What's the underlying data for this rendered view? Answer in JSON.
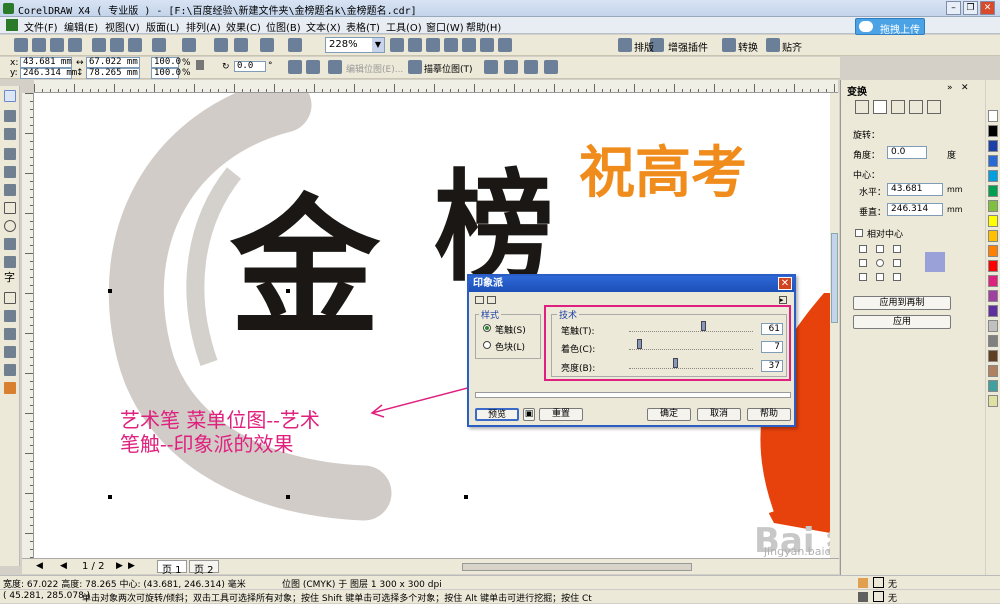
{
  "window": {
    "title": "CorelDRAW X4 ( 专业版 ) - [F:\\百度经验\\新建文件夹\\金榜题名k\\金榜题名.cdr]"
  },
  "menu": [
    "文件(F)",
    "编辑(E)",
    "视图(V)",
    "版面(L)",
    "排列(A)",
    "效果(C)",
    "位图(B)",
    "文本(X)",
    "表格(T)",
    "工具(O)",
    "窗口(W)",
    "帮助(H)"
  ],
  "upload_button": "拖拽上传",
  "toolbar": {
    "zoom": "228%",
    "paiban": "排版",
    "zengqiang": "增强插件",
    "zhuanhuan": "转换",
    "tieqi": "贴齐"
  },
  "property_bar": {
    "x": "43.681 mm",
    "y": "246.314 mm",
    "w": "67.022 mm",
    "h": "78.265 mm",
    "sx": "100.0",
    "sy": "100.0",
    "pct": "%",
    "rotation": "0.0",
    "deg": "°",
    "edit_bitmap": "编辑位图(E)...",
    "trace_bitmap": "描摹位图(T)"
  },
  "canvas": {
    "headline": "祝高考",
    "calligraphy_1": "金",
    "calligraphy_2": "榜",
    "annotation_line1": "艺术笔  菜单位图--艺术",
    "annotation_line2": "笔触--印象派的效果"
  },
  "dialog": {
    "title": "印象派",
    "style_group": "样式",
    "style_options": [
      "笔触(S)",
      "色块(L)"
    ],
    "tech_group": "技术",
    "params": [
      {
        "label": "笔触(T):",
        "value": "61",
        "fraction": 0.61
      },
      {
        "label": "着色(C):",
        "value": "7",
        "fraction": 0.07
      },
      {
        "label": "亮度(B):",
        "value": "37",
        "fraction": 0.37
      }
    ],
    "buttons": {
      "preview": "预览",
      "reset": "重置",
      "ok": "确定",
      "cancel": "取消",
      "help": "帮助"
    }
  },
  "pages": {
    "indicator": "1 / 2",
    "tabs": [
      "页 1",
      "页 2"
    ]
  },
  "status": {
    "line1_left": "宽度: 67.022 高度: 78.265 中心: (43.681, 246.314) 毫米",
    "line1_mid": "位图 (CMYK) 于 图层 1 300 x 300 dpi",
    "line2_left": "( 45.281, 285.078 )",
    "line2_mid": "单击对象两次可旋转/倾斜；双击工具可选择所有对象；按住 Shift 键单击可选择多个对象；按住 Alt 键单击可进行挖掘；按住 Ctrl 并单...",
    "fill_none": "无",
    "outline_none": "无"
  },
  "docker": {
    "title": "变换",
    "rotate_label": "旋转：",
    "angle_label": "角度：",
    "angle_value": "0.0",
    "angle_unit": "度",
    "center_label": "中心：",
    "h_label": "水平：",
    "h_value": "43.681",
    "v_label": "垂直：",
    "v_value": "246.314",
    "unit": "mm",
    "relative_center": "相对中心",
    "apply_copy": "应用到再制",
    "apply": "应用"
  },
  "palette_colors": [
    "#ffffff",
    "#000000",
    "#1c3fa8",
    "#2a6ad6",
    "#00a0e0",
    "#00a050",
    "#80c040",
    "#ffff00",
    "#ffc000",
    "#ff8000",
    "#ff0000",
    "#e0207f",
    "#a040a0",
    "#6030a0",
    "#c0c0c0",
    "#808080",
    "#604020",
    "#b08060",
    "#40a0a0",
    "#e0e0a0"
  ],
  "watermark": {
    "brand": "Bai 经验",
    "url": "jingyan.baidu.com"
  },
  "colors": {
    "accent_pink": "#e0207f",
    "orange_text": "#f08c1c",
    "orange_red": "#e8420c"
  }
}
